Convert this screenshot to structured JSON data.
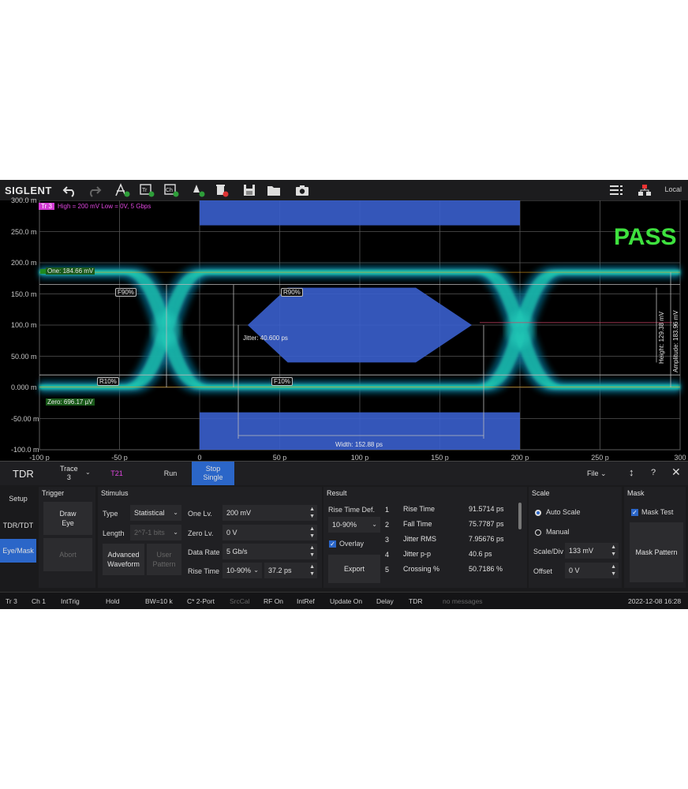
{
  "toolbar": {
    "brand": "SIGLENT",
    "local": "Local",
    "icons": [
      "undo-icon",
      "redo-icon",
      "add-trace-icon",
      "add-tr-icon",
      "add-ch-icon",
      "add-marker-icon",
      "delete-icon",
      "save-icon",
      "open-folder-icon",
      "camera-icon",
      "list-icon",
      "network-icon"
    ]
  },
  "plot": {
    "trace_tag": "Tr 3",
    "trace_info": "High = 200 mV  Low = 0V,  5 Gbps",
    "pass_text": "PASS",
    "one_level": "One: 184.66 mV",
    "zero_level": "Zero: 696.17 µV",
    "f90": "F90%",
    "r90": "R90%",
    "r10": "R10%",
    "f10": "F10%",
    "jitter": "Jitter: 40.600 ps",
    "width": "Width: 152.88 ps",
    "height": "Height: 129.38 mV",
    "amplitude": "Amplitude: 183.96 mV"
  },
  "chart_data": {
    "type": "eye-diagram",
    "y_ticks": [
      "300.0 m",
      "250.0 m",
      "200.0 m",
      "150.0 m",
      "100.0 m",
      "50.00 m",
      "0.000 m",
      "-50.00 m",
      "-100.0 m"
    ],
    "x_ticks": [
      "-100 p",
      "-50 p",
      "0",
      "50 p",
      "100 p",
      "150 p",
      "200 p",
      "250 p",
      "300 p"
    ],
    "xlim": [
      -100,
      300
    ],
    "ylim": [
      -100,
      300
    ],
    "x_unit": "ps",
    "y_unit": "mV",
    "one_level_mv": 184.66,
    "zero_level_mv": 0.696,
    "mask": {
      "top_bar": {
        "x": [
          0,
          200
        ],
        "y": [
          260,
          300
        ]
      },
      "bottom_bar": {
        "x": [
          0,
          200
        ],
        "y": [
          -100,
          -40
        ]
      },
      "hexagon": [
        [
          30,
          100
        ],
        [
          55,
          160
        ],
        [
          135,
          160
        ],
        [
          170,
          100
        ],
        [
          135,
          40
        ],
        [
          55,
          40
        ]
      ]
    },
    "eye_crossings_ps": [
      -21,
      200
    ]
  },
  "panel": {
    "title": "TDR",
    "trace_label": "Trace",
    "trace_value": "3",
    "t21": "T21",
    "run": "Run",
    "stop_single_1": "Stop",
    "stop_single_2": "Single",
    "file": "File",
    "side_tabs": [
      "Setup",
      "TDR/TDT",
      "Eye/Mask"
    ],
    "trigger": {
      "title": "Trigger",
      "draw_eye_1": "Draw",
      "draw_eye_2": "Eye",
      "abort": "Abort"
    },
    "stimulus": {
      "title": "Stimulus",
      "type_label": "Type",
      "type_value": "Statistical",
      "length_label": "Length",
      "length_value": "2^7-1 bits",
      "adv_1": "Advanced",
      "adv_2": "Waveform",
      "user_1": "User",
      "user_2": "Pattern",
      "one_lv_label": "One Lv.",
      "one_lv_value": "200 mV",
      "zero_lv_label": "Zero Lv.",
      "zero_lv_value": "0 V",
      "data_rate_label": "Data Rate",
      "data_rate_value": "5 Gb/s",
      "rise_time_label": "Rise Time",
      "rise_time_def": "10-90%",
      "rise_time_value": "37.2 ps"
    },
    "result": {
      "title": "Result",
      "rise_def_label": "Rise Time Def.",
      "rise_def_value": "10-90%",
      "overlay": "Overlay",
      "export": "Export",
      "rows": [
        {
          "num": "1",
          "name": "Rise Time",
          "value": "91.5714 ps"
        },
        {
          "num": "2",
          "name": "Fall Time",
          "value": "75.7787 ps"
        },
        {
          "num": "3",
          "name": "Jitter RMS",
          "value": "7.95676 ps"
        },
        {
          "num": "4",
          "name": "Jitter p-p",
          "value": "40.6 ps"
        },
        {
          "num": "5",
          "name": "Crossing %",
          "value": "50.7186 %"
        }
      ]
    },
    "scale": {
      "title": "Scale",
      "auto": "Auto Scale",
      "manual": "Manual",
      "scale_div_label": "Scale/Div",
      "scale_div_value": "133 mV",
      "offset_label": "Offset",
      "offset_value": "0 V"
    },
    "mask": {
      "title": "Mask",
      "mask_test": "Mask Test",
      "mask_pattern": "Mask Pattern"
    }
  },
  "status": {
    "items": [
      "Tr 3",
      "Ch 1",
      "IntTrig",
      "Hold",
      "BW=10 k",
      "C* 2-Port",
      "SrcCal",
      "RF On",
      "IntRef",
      "Update On",
      "Delay",
      "TDR",
      "no messages"
    ],
    "datetime": "2022-12-08 16:28"
  },
  "colors": {
    "accent": "#2b66c8",
    "pass": "#3ee23e",
    "mask": "#3a5fcd",
    "trace_tag": "#d23ad2"
  }
}
